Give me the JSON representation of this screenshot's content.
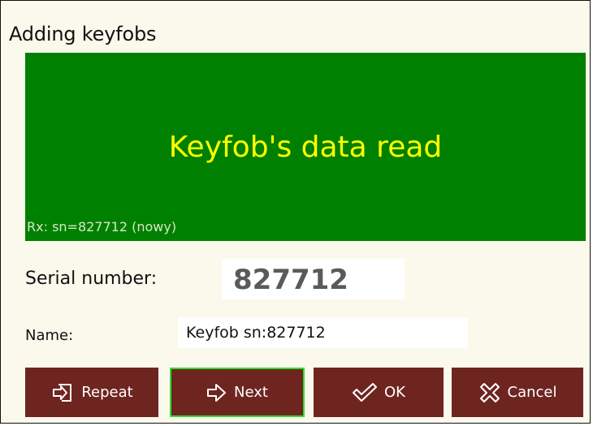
{
  "dialog": {
    "title": "Adding keyfobs"
  },
  "status": {
    "message": "Keyfob's data read",
    "rx_line": "Rx: sn=827712 (nowy)",
    "background_color": "#008000",
    "text_color": "#ffff00"
  },
  "fields": {
    "serial_label": "Serial number:",
    "serial_value": "827712",
    "name_label": "Name:",
    "name_value": "Keyfob sn:827712"
  },
  "buttons": {
    "repeat": {
      "label": "Repeat",
      "icon": "repeat-icon"
    },
    "next": {
      "label": "Next",
      "icon": "arrow-right-icon"
    },
    "ok": {
      "label": "OK",
      "icon": "check-icon"
    },
    "cancel": {
      "label": "Cancel",
      "icon": "cancel-icon"
    },
    "button_color": "#6e2520",
    "active_border_color": "#33dd33"
  }
}
